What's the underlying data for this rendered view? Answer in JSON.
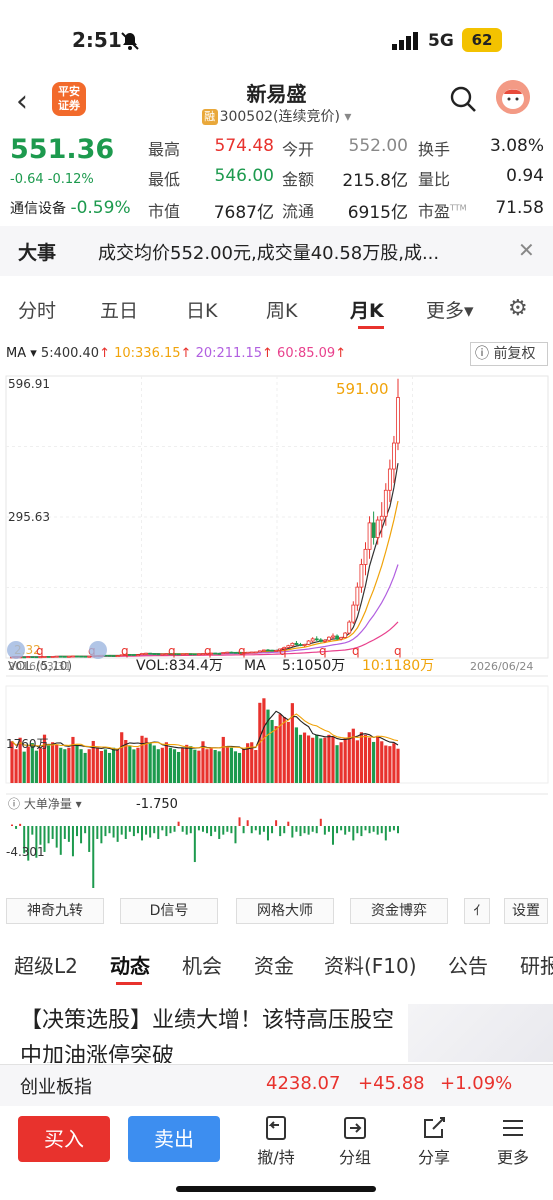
{
  "status": {
    "time": "2:51",
    "network": "5G",
    "battery": "62"
  },
  "header": {
    "logo_line1": "平安",
    "logo_line2": "证券",
    "stock_name": "新易盛",
    "rong_badge": "融",
    "stock_code": "300502(连续竞价)"
  },
  "quote": {
    "price": "551.36",
    "change": "-0.64 -0.12%",
    "sector_name": "通信设备",
    "sector_change": "-0.59%",
    "fields": [
      {
        "label": "最高",
        "value": "574.48",
        "color": "#e8322d"
      },
      {
        "label": "今开",
        "value": "552.00",
        "color": "#888888"
      },
      {
        "label": "换手",
        "value": "3.08%",
        "color": "#222222"
      },
      {
        "label": "最低",
        "value": "546.00",
        "color": "#1d9a4e"
      },
      {
        "label": "金额",
        "value": "215.8亿",
        "color": "#222222"
      },
      {
        "label": "量比",
        "value": "0.94",
        "color": "#222222"
      },
      {
        "label": "市值",
        "value": "7687亿",
        "color": "#222222"
      },
      {
        "label": "流通",
        "value": "6915亿",
        "color": "#222222"
      },
      {
        "label": "市盈",
        "value": "71.58",
        "color": "#222222",
        "sup": "TTM"
      }
    ]
  },
  "news": {
    "tag": "大事",
    "text": "成交均价552.00元,成交量40.58万股,成..."
  },
  "period_tabs": [
    "分时",
    "五日",
    "日K",
    "周K",
    "月K",
    "更多▾"
  ],
  "ma": {
    "label": "MA ▾",
    "ma5": "5:400.40",
    "ma10": "10:336.15",
    "ma20": "20:211.15",
    "ma60": "60:85.09",
    "arrow": "↑",
    "fq_label": "前复权",
    "colors": {
      "ma5": "#333333",
      "ma10": "#f0a30a",
      "ma20": "#b15fe0",
      "ma60": "#e8418d"
    }
  },
  "chart_data": {
    "type": "candlestick",
    "y_max_label": "596.91",
    "y_mid_label": "295.63",
    "y_min_label": "2.32",
    "peak_label": "591.00",
    "x_start": "2016/03/31",
    "x_end": "2026/06/24",
    "ylim": [
      0,
      596.91
    ],
    "q_marker": "q",
    "candles": [
      [
        2,
        2.3,
        1.8,
        2.2
      ],
      [
        2.2,
        2.5,
        2,
        2.3
      ],
      [
        2.3,
        2.6,
        2.1,
        2.4
      ],
      [
        2.4,
        2.5,
        2.1,
        2.2
      ],
      [
        2.2,
        3,
        2.1,
        2.9
      ],
      [
        2.9,
        3.2,
        2.6,
        2.7
      ],
      [
        2.7,
        2.9,
        2.4,
        2.5
      ],
      [
        2.5,
        2.8,
        2.3,
        2.6
      ],
      [
        2.6,
        3.5,
        2.5,
        3.3
      ],
      [
        3.3,
        3.6,
        3,
        3.1
      ],
      [
        3.1,
        3.4,
        2.9,
        3.2
      ],
      [
        3.2,
        4,
        3.1,
        3.8
      ],
      [
        3.8,
        4.2,
        3.4,
        3.6
      ],
      [
        3.6,
        3.8,
        3.2,
        3.4
      ],
      [
        3.4,
        3.7,
        3.1,
        3.5
      ],
      [
        3.5,
        4.5,
        3.4,
        4.2
      ],
      [
        4.2,
        4.6,
        3.8,
        4
      ],
      [
        4,
        4.2,
        3.6,
        3.8
      ],
      [
        3.8,
        4,
        3.4,
        3.5
      ],
      [
        3.5,
        3.8,
        3.2,
        3.6
      ],
      [
        3.6,
        5,
        3.5,
        4.8
      ],
      [
        4.8,
        5.5,
        4.5,
        5.2
      ],
      [
        5.2,
        6,
        4.9,
        5.8
      ],
      [
        5.8,
        6.4,
        5.3,
        5.6
      ],
      [
        5.6,
        6,
        5,
        5.2
      ],
      [
        5.2,
        5.5,
        4.6,
        4.8
      ],
      [
        4.8,
        5.2,
        4.4,
        5
      ],
      [
        5,
        7,
        4.9,
        6.8
      ],
      [
        6.8,
        8,
        6.4,
        7.6
      ],
      [
        7.6,
        8.4,
        7,
        7.4
      ],
      [
        7.4,
        7.8,
        6.6,
        6.9
      ],
      [
        6.9,
        7.5,
        6.5,
        7.2
      ],
      [
        7.2,
        10,
        7,
        9.5
      ],
      [
        9.5,
        11,
        8.8,
        10.2
      ],
      [
        10.2,
        10.8,
        9,
        9.4
      ],
      [
        9.4,
        9.8,
        8.4,
        8.8
      ],
      [
        8.8,
        9.2,
        7.8,
        8.1
      ],
      [
        8.1,
        8.6,
        7.5,
        8.3
      ],
      [
        8.3,
        9.5,
        8,
        9.1
      ],
      [
        9.1,
        9.8,
        8.6,
        9
      ],
      [
        9,
        9.6,
        8.4,
        8.8
      ],
      [
        8.8,
        9,
        7.9,
        8.2
      ],
      [
        8.2,
        8.8,
        7.8,
        8.5
      ],
      [
        8.5,
        9.2,
        8.2,
        9
      ],
      [
        9,
        9.4,
        8.5,
        8.7
      ],
      [
        8.7,
        9,
        8.2,
        8.4
      ],
      [
        8.4,
        8.8,
        8,
        8.6
      ],
      [
        8.6,
        9.5,
        8.4,
        9.2
      ],
      [
        9.2,
        10.5,
        9,
        10.1
      ],
      [
        10.1,
        11,
        9.6,
        10.4
      ],
      [
        10.4,
        10.8,
        9.5,
        9.8
      ],
      [
        9.8,
        10.2,
        9.2,
        9.6
      ],
      [
        9.6,
        12,
        9.5,
        11.6
      ],
      [
        11.6,
        13,
        11,
        12.4
      ],
      [
        12.4,
        13.5,
        11.8,
        12
      ],
      [
        12,
        12.6,
        11,
        11.4
      ],
      [
        11.4,
        11.8,
        10.4,
        10.8
      ],
      [
        10.8,
        11.4,
        10.2,
        11
      ],
      [
        11,
        12.5,
        10.8,
        12.2
      ],
      [
        12.2,
        13,
        11.6,
        12.6
      ],
      [
        12.6,
        13.5,
        12,
        12.8
      ],
      [
        12.8,
        16,
        12.5,
        15.2
      ],
      [
        15.2,
        18,
        14.5,
        17
      ],
      [
        17,
        19,
        16,
        16.6
      ],
      [
        16.6,
        17.5,
        15,
        15.6
      ],
      [
        15.6,
        16.5,
        14.8,
        16
      ],
      [
        16,
        20,
        15.8,
        19.2
      ],
      [
        19.2,
        24,
        18.5,
        22.5
      ],
      [
        22.5,
        28,
        21,
        26
      ],
      [
        26,
        33,
        24,
        31
      ],
      [
        31,
        36,
        27,
        28.5
      ],
      [
        28.5,
        32,
        25,
        26.4
      ],
      [
        26.4,
        30,
        24,
        28.8
      ],
      [
        28.8,
        38,
        27.5,
        36
      ],
      [
        36,
        44,
        33,
        40.5
      ],
      [
        40.5,
        46,
        36,
        38.4
      ],
      [
        38.4,
        42,
        33,
        35
      ],
      [
        35,
        40,
        32,
        37.6
      ],
      [
        37.6,
        46,
        36,
        44
      ],
      [
        44,
        52,
        40,
        46.5
      ],
      [
        46.5,
        50,
        38,
        40.2
      ],
      [
        40.2,
        45,
        37,
        43.5
      ],
      [
        43.5,
        55,
        42,
        52.8
      ],
      [
        52.8,
        80,
        50,
        76
      ],
      [
        76,
        120,
        72,
        112
      ],
      [
        112,
        160,
        100,
        150
      ],
      [
        150,
        210,
        138,
        198
      ],
      [
        198,
        245,
        175,
        230
      ],
      [
        230,
        300,
        210,
        286
      ],
      [
        286,
        310,
        240,
        255
      ],
      [
        255,
        300,
        240,
        292
      ],
      [
        292,
        330,
        255,
        300
      ],
      [
        300,
        370,
        280,
        355
      ],
      [
        355,
        420,
        330,
        400
      ],
      [
        400,
        470,
        370,
        455
      ],
      [
        455,
        591,
        440,
        551.36
      ]
    ],
    "volume": {
      "label": "VOL (5,10)",
      "value": "VOL:834.4万",
      "ma_label": "MA",
      "ma5": "5:1050万",
      "ma10": "10:1180万",
      "axis_label": "1760万",
      "values": [
        1290,
        1045,
        1400,
        970,
        1130,
        1235,
        1000,
        1075,
        1495,
        1160,
        1260,
        1190,
        1090,
        1045,
        1090,
        1425,
        1160,
        1045,
        930,
        1045,
        1300,
        1090,
        990,
        1040,
        930,
        1090,
        1045,
        1570,
        1330,
        1160,
        1040,
        1090,
        1460,
        1400,
        1230,
        1160,
        1045,
        1090,
        1260,
        1090,
        1045,
        960,
        1090,
        1180,
        1140,
        1030,
        1000,
        1290,
        1045,
        1090,
        1020,
        980,
        1425,
        1140,
        1090,
        980,
        930,
        1045,
        1230,
        1260,
        1020,
        2480,
        2620,
        2270,
        1950,
        1760,
        2130,
        2040,
        1890,
        2470,
        1720,
        1490,
        1560,
        1470,
        1400,
        1490,
        1380,
        1400,
        1490,
        1430,
        1170,
        1260,
        1400,
        1570,
        1680,
        1320,
        1570,
        1490,
        1400,
        1270,
        1460,
        1290,
        1160,
        1140,
        1230,
        1060
      ]
    },
    "flow": {
      "label": "大单净量",
      "value": "-1.750",
      "axis_label": "-4.301",
      "values": [
        0.1,
        -0.2,
        0.15,
        -1.9,
        -2.4,
        -0.6,
        -2.2,
        -1.3,
        -1.8,
        -1.2,
        -0.9,
        -1.5,
        -2.0,
        -0.9,
        -1.1,
        -2.1,
        -0.7,
        -1.2,
        -0.5,
        -1.8,
        -4.3,
        -0.9,
        -1.2,
        -0.7,
        -0.5,
        -0.8,
        -1.1,
        -0.6,
        -0.9,
        -0.4,
        -0.7,
        -0.5,
        -1.0,
        -0.6,
        -0.8,
        -0.5,
        -0.9,
        -0.3,
        -0.7,
        -0.5,
        -0.4,
        0.3,
        -0.4,
        -0.6,
        -0.5,
        -2.5,
        -0.3,
        -0.4,
        -0.5,
        -0.7,
        -0.4,
        -0.9,
        -0.6,
        -0.4,
        -0.5,
        -1.2,
        0.6,
        -0.5,
        0.4,
        -0.5,
        -0.3,
        -0.6,
        -0.4,
        -1.0,
        -0.5,
        0.4,
        -0.7,
        -0.5,
        0.3,
        -0.8,
        -0.4,
        -0.7,
        -0.5,
        -0.6,
        -0.4,
        -0.5,
        0.5,
        -0.6,
        -0.4,
        -1.3,
        -0.5,
        -0.3,
        -0.6,
        -0.4,
        -1.0,
        -0.5,
        -0.7,
        -0.3,
        -0.5,
        -0.4,
        -0.6,
        -0.5,
        -1.0,
        -0.4,
        -0.3,
        -0.5
      ]
    }
  },
  "indicator_buttons": [
    "神奇九转",
    "D信号",
    "网格大师",
    "资金博弈",
    "ｲ",
    "设置"
  ],
  "bottom_tabs": [
    "超级L2",
    "动态",
    "机会",
    "资金",
    "资料(F10)",
    "公告",
    "研报"
  ],
  "article": {
    "title": "【决策选股】业绩大增！该特高压股空中加油涨停突破"
  },
  "index": {
    "name": "创业板指",
    "value": "4238.07",
    "change": "+45.88",
    "pct": "+1.09%"
  },
  "actions": {
    "buy": "买入",
    "sell": "卖出",
    "hold": "撤/持",
    "group": "分组",
    "share": "分享",
    "more": "更多"
  }
}
